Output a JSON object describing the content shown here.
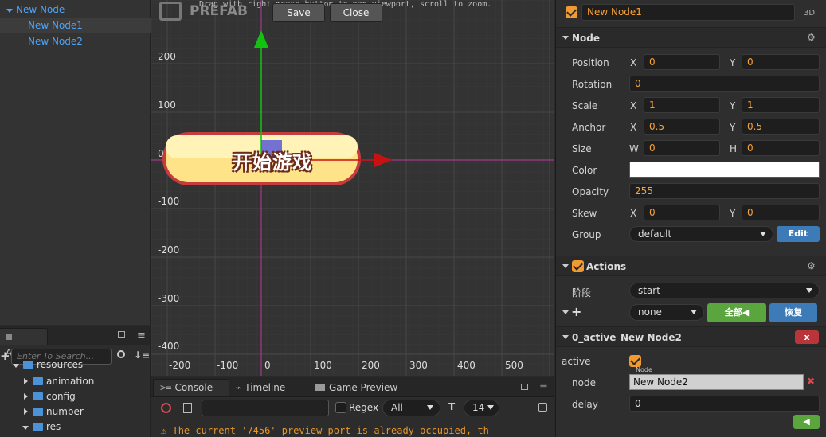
{
  "hierarchy": {
    "items": [
      {
        "label": "New Node"
      },
      {
        "label": "New Node1"
      },
      {
        "label": "New Node2"
      }
    ]
  },
  "assets": {
    "tab": "Assets",
    "search_placeholder": "Enter To Search...",
    "tree": [
      {
        "label": "resources"
      },
      {
        "label": "animation"
      },
      {
        "label": "config"
      },
      {
        "label": "number"
      },
      {
        "label": "res"
      }
    ]
  },
  "scene": {
    "prefab_label": "PREFAB",
    "hint": "Drag with right mouse button to pan viewport, scroll to zoom.",
    "save": "Save",
    "close": "Close",
    "y_ticks": [
      "200",
      "100",
      "0",
      "-100",
      "-200",
      "-300",
      "-400"
    ],
    "x_ticks": [
      "-200",
      "-100",
      "0",
      "100",
      "200",
      "300",
      "400",
      "500"
    ],
    "button_text": "开始游戏"
  },
  "console": {
    "tabs": {
      "console": "Console",
      "timeline": "Timeline",
      "game_preview": "Game Preview"
    },
    "regex": "Regex",
    "filter": "All",
    "font_size": "14",
    "message": "The current '7456' preview port is already occupied, th"
  },
  "inspector": {
    "node_name": "New Node1",
    "mode": "3D",
    "node_section": "Node",
    "position": {
      "label": "Position",
      "x": "0",
      "y": "0"
    },
    "rotation": {
      "label": "Rotation",
      "value": "0"
    },
    "scale": {
      "label": "Scale",
      "x": "1",
      "y": "1"
    },
    "anchor": {
      "label": "Anchor",
      "x": "0.5",
      "y": "0.5"
    },
    "size": {
      "label": "Size",
      "w": "0",
      "h": "0"
    },
    "color": {
      "label": "Color",
      "value": "#ffffff"
    },
    "opacity": {
      "label": "Opacity",
      "value": "255"
    },
    "skew": {
      "label": "Skew",
      "x": "0",
      "y": "0"
    },
    "group": {
      "label": "Group",
      "value": "default",
      "edit": "Edit"
    },
    "axis": {
      "x": "X",
      "y": "Y",
      "w": "W",
      "h": "H"
    },
    "actions_section": "Actions",
    "stage": {
      "label": "阶段",
      "value": "start"
    },
    "add_row": {
      "select": "none",
      "all_btn": "全部◀",
      "restore_btn": "恢复"
    },
    "active_block": {
      "title": "0_active",
      "target": "New Node2",
      "remove": "x",
      "active_label": "active",
      "node_label": "node",
      "node_value": "New Node2",
      "node_hint": "Node",
      "delay_label": "delay",
      "delay_value": "0",
      "play": "◀"
    }
  },
  "colors": {
    "accent": "#f09a30",
    "link": "#4fa3f7",
    "green": "#5aa53e",
    "blue": "#3d7ab8",
    "red": "#b8363a"
  }
}
